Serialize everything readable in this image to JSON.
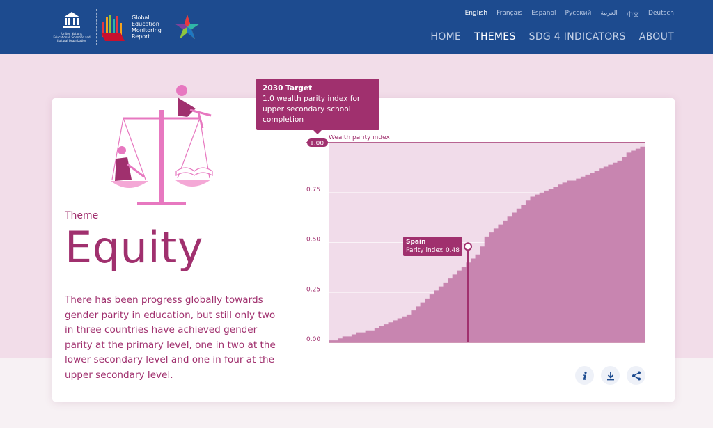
{
  "header": {
    "unesco_org_lines": [
      "United Nations",
      "Educational, Scientific and",
      "Cultural Organization"
    ],
    "gem_lines": [
      "Global",
      "Education",
      "Monitoring",
      "Report"
    ],
    "languages": [
      "English",
      "Français",
      "Español",
      "Русский",
      "العربية",
      "中文",
      "Deutsch"
    ],
    "active_language": "English",
    "nav": [
      "HOME",
      "THEMES",
      "SDG 4 INDICATORS",
      "ABOUT"
    ],
    "active_nav": "THEMES",
    "colors": {
      "bar": "#1d4b8f",
      "accent": "#a0306e"
    }
  },
  "theme": {
    "label": "Theme",
    "title": "Equity",
    "description": "There has been progress globally towards gender parity in education, but still only two in three countries have achieved gender parity at the primary level, one in two at the lower secondary level and one in four at the upper secondary level."
  },
  "tooltip_target": {
    "title": "2030 Target",
    "body": "1.0 wealth parity index for upper secondary school completion"
  },
  "tooltip_country": {
    "country": "Spain",
    "metric_label": "Parity index",
    "value": "0.48"
  },
  "chart_data": {
    "type": "area",
    "target_label": "1.00",
    "series_label": "Wealth parity index",
    "y_ticks": [
      "1.00",
      "0.75",
      "0.50",
      "0.25",
      "0.00"
    ],
    "ylim": [
      0,
      1
    ],
    "highlight": {
      "country": "Spain",
      "value": 0.48
    },
    "values": [
      0.01,
      0.01,
      0.02,
      0.03,
      0.03,
      0.04,
      0.05,
      0.05,
      0.06,
      0.06,
      0.07,
      0.08,
      0.09,
      0.1,
      0.11,
      0.12,
      0.13,
      0.14,
      0.16,
      0.18,
      0.2,
      0.22,
      0.24,
      0.26,
      0.28,
      0.3,
      0.32,
      0.34,
      0.36,
      0.38,
      0.4,
      0.42,
      0.44,
      0.48,
      0.53,
      0.55,
      0.57,
      0.59,
      0.61,
      0.63,
      0.65,
      0.67,
      0.69,
      0.71,
      0.73,
      0.74,
      0.75,
      0.76,
      0.77,
      0.78,
      0.79,
      0.8,
      0.81,
      0.81,
      0.82,
      0.83,
      0.84,
      0.85,
      0.86,
      0.87,
      0.88,
      0.89,
      0.9,
      0.91,
      0.93,
      0.95,
      0.96,
      0.97,
      0.98,
      1.0
    ]
  },
  "actions": [
    "info-icon",
    "download-icon",
    "share-icon"
  ]
}
